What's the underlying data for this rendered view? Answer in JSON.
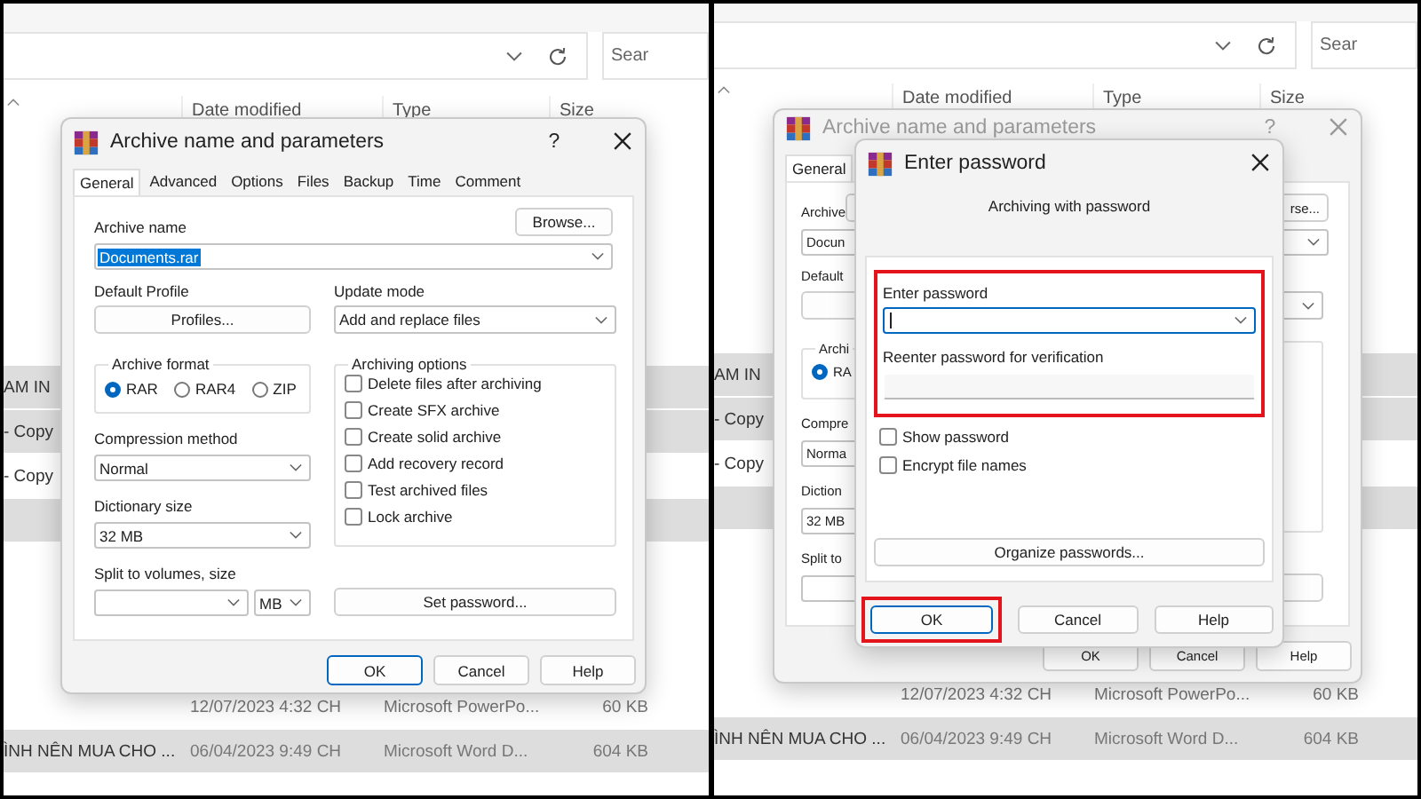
{
  "left_panel": {
    "explorer": {
      "search": {
        "placeholder": "Sear"
      },
      "columns": [
        "Date modified",
        "Type",
        "Size"
      ],
      "rows": [
        {
          "name": "AM IN",
          "selected": true
        },
        {
          "name": "- Copy",
          "selected": true
        },
        {
          "name": "- Copy",
          "selected": false
        },
        {
          "selected": true
        },
        {
          "date": "12/07/2023 4:32 CH",
          "type": "Microsoft PowerPo...",
          "size": "60 KB",
          "selected": false
        },
        {
          "name": "ÌNH NÊN MUA CHO ...",
          "date": "06/04/2023 9:49 CH",
          "type": "Microsoft Word D...",
          "size": "604 KB",
          "selected": true
        }
      ]
    },
    "dialog": {
      "title": "Archive name and parameters",
      "active": true,
      "help": "?",
      "tabs": [
        {
          "label": "General",
          "selected": true
        },
        {
          "label": "Advanced",
          "selected": false
        },
        {
          "label": "Options",
          "selected": false
        },
        {
          "label": "Files",
          "selected": false
        },
        {
          "label": "Backup",
          "selected": false
        },
        {
          "label": "Time",
          "selected": false
        },
        {
          "label": "Comment",
          "selected": false
        }
      ],
      "archive_name": {
        "label": "Archive name",
        "value": "Documents.rar",
        "text_selected": true
      },
      "browse": "Browse...",
      "profile": {
        "label": "Default Profile",
        "button": "Profiles..."
      },
      "update_mode": {
        "label": "Update mode",
        "value": "Add and replace files"
      },
      "archive_format": {
        "label": "Archive format",
        "options": [
          {
            "label": "RAR",
            "selected": true
          },
          {
            "label": "RAR4",
            "selected": false
          },
          {
            "label": "ZIP",
            "selected": false
          }
        ]
      },
      "archiving_options": {
        "label": "Archiving options",
        "options": [
          {
            "label": "Delete files after archiving",
            "checked": false
          },
          {
            "label": "Create SFX archive",
            "checked": false
          },
          {
            "label": "Create solid archive",
            "checked": false
          },
          {
            "label": "Add recovery record",
            "checked": false
          },
          {
            "label": "Test archived files",
            "checked": false
          },
          {
            "label": "Lock archive",
            "checked": false
          }
        ]
      },
      "compression_method": {
        "label": "Compression method",
        "value": "Normal"
      },
      "dictionary_size": {
        "label": "Dictionary size",
        "value": "32 MB"
      },
      "split": {
        "label": "Split to volumes, size",
        "unit": "MB"
      },
      "set_password": "Set password...",
      "buttons": [
        {
          "label": "OK",
          "default": true
        },
        {
          "label": "Cancel",
          "default": false
        },
        {
          "label": "Help",
          "default": false
        }
      ]
    }
  },
  "right_panel": {
    "explorer": {
      "search": {
        "placeholder": "Sear"
      },
      "columns": [
        "Date modified",
        "Type",
        "Size"
      ],
      "rows": [
        {
          "name": "AM IN",
          "selected": true
        },
        {
          "name": "- Copy",
          "selected": true
        },
        {
          "name": "- Copy",
          "selected": false
        },
        {
          "selected": true
        },
        {
          "date": "12/07/2023 4:32 CH",
          "type": "Microsoft PowerPo...",
          "size": "60 KB",
          "selected": false
        },
        {
          "name": "ÌNH NÊN MUA CHO ...",
          "date": "06/04/2023 9:49 CH",
          "type": "Microsoft Word D...",
          "size": "604 KB",
          "selected": true
        }
      ]
    },
    "dialog": {
      "title": "Archive name and parameters",
      "active": false,
      "help": "?",
      "tabs": [
        {
          "label": "General",
          "selected": true
        }
      ],
      "archive_name": {
        "label": "Archive",
        "value": "Docun",
        "text_selected": false
      },
      "browse": "rse...",
      "profile": {
        "label": "Default"
      },
      "archive_format": {
        "label": "Archi",
        "options": [
          {
            "label": "RA",
            "selected": true
          }
        ]
      },
      "compression_method": {
        "label": "Compre",
        "value": "Norma"
      },
      "dictionary_size": {
        "label": "Diction",
        "value": "32 MB"
      },
      "split": {
        "label": "Split to"
      },
      "buttons": [
        {
          "label": "OK",
          "default": false
        },
        {
          "label": "Cancel",
          "default": false
        },
        {
          "label": "Help",
          "default": false
        }
      ]
    },
    "password_dialog": {
      "title": "Enter password",
      "heading": "Archiving with password",
      "highlighted": true,
      "password": {
        "label": "Enter password"
      },
      "verify": {
        "label": "Reenter password for verification"
      },
      "options": [
        {
          "label": "Show password",
          "checked": false
        },
        {
          "label": "Encrypt file names",
          "checked": false
        }
      ],
      "organize": "Organize passwords...",
      "buttons": [
        {
          "label": "OK",
          "default": true,
          "highlighted": true
        },
        {
          "label": "Cancel",
          "default": false,
          "highlighted": false
        },
        {
          "label": "Help",
          "default": false,
          "highlighted": false
        }
      ]
    }
  }
}
